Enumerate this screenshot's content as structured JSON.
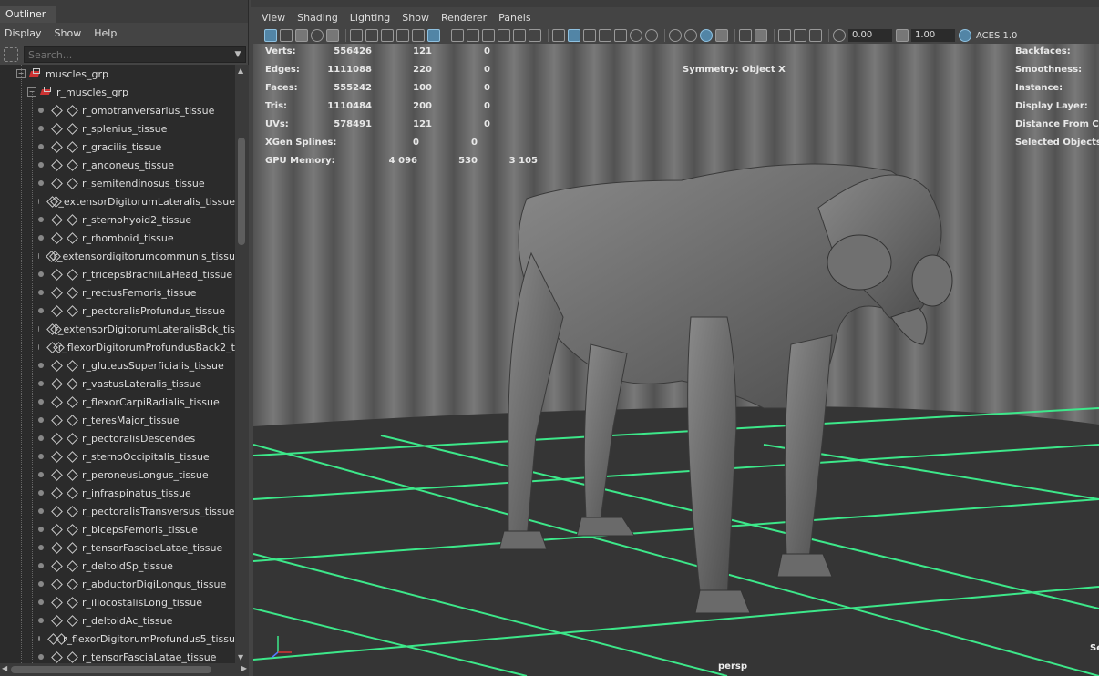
{
  "outliner": {
    "tab": "Outliner",
    "menu": [
      "Display",
      "Show",
      "Help"
    ],
    "search_placeholder": "Search...",
    "root_group": "muscles_grp",
    "sub_group": "r_muscles_grp",
    "items": [
      "r_omotranversarius_tissue",
      "r_splenius_tissue",
      "r_gracilis_tissue",
      "r_anconeus_tissue",
      "r_semitendinosus_tissue",
      "r_extensorDigitorumLateralis_tissue",
      "r_sternohyoid2_tissue",
      "r_rhomboid_tissue",
      "r_extensordigitorumcommunis_tissu",
      "r_tricepsBrachiiLaHead_tissue",
      "r_rectusFemoris_tissue",
      "r_pectoralisProfundus_tissue",
      "r_extensorDigitorumLateralisBck_tis",
      "r_flexorDigitorumProfundusBack2_t",
      "r_gluteusSuperficialis_tissue",
      "r_vastusLateralis_tissue",
      "r_flexorCarpiRadialis_tissue",
      "r_teresMajor_tissue",
      "r_pectoralisDescendes",
      "r_sternoOccipitalis_tissue",
      "r_peroneusLongus_tissue",
      "r_infraspinatus_tissue",
      "r_pectoralisTransversus_tissue",
      "r_bicepsFemoris_tissue",
      "r_tensorFasciaeLatae_tissue",
      "r_deltoidSp_tissue",
      "r_abductorDigiLongus_tissue",
      "r_iliocostalisLong_tissue",
      "r_deltoidAc_tissue",
      "r_flexorDigitorumProfundus5_tissu",
      "r_tensorFasciaLatae_tissue"
    ]
  },
  "viewport": {
    "menus": [
      "View",
      "Shading",
      "Lighting",
      "Show",
      "Renderer",
      "Panels"
    ],
    "toolbar": {
      "field1": "0.00",
      "field2": "1.00",
      "color_space": "ACES 1.0"
    },
    "hud_left": [
      {
        "label": "Verts:",
        "v1": "556426",
        "v2": "121",
        "v3": "0"
      },
      {
        "label": "Edges:",
        "v1": "1111088",
        "v2": "220",
        "v3": "0"
      },
      {
        "label": "Faces:",
        "v1": "555242",
        "v2": "100",
        "v3": "0"
      },
      {
        "label": "Tris:",
        "v1": "1110484",
        "v2": "200",
        "v3": "0"
      },
      {
        "label": "UVs:",
        "v1": "578491",
        "v2": "121",
        "v3": "0"
      }
    ],
    "xgen": {
      "label": "XGen Splines:",
      "v1": "0",
      "v2": "0"
    },
    "gpu": {
      "label": "GPU Memory:",
      "v1": "4 096",
      "v2": "530",
      "v3": "3 105"
    },
    "symmetry": "Symmetry: Object X",
    "hud_right": [
      "Backfaces:",
      "Smoothness:",
      "Instance:",
      "Display Layer:",
      "Distance From Ca",
      "Selected Objects:"
    ],
    "camera": "persp",
    "corner_text": "Se",
    "colors": {
      "grid": "#3de88a",
      "ground": "#353535",
      "curtain": "#707070",
      "highlight": "#5285a6"
    }
  }
}
